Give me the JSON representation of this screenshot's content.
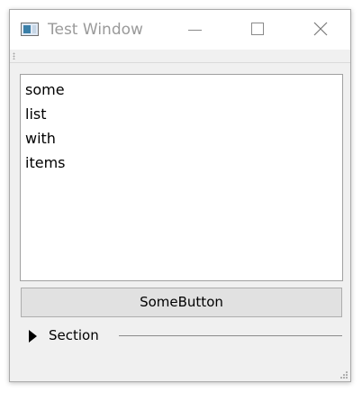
{
  "window": {
    "title": "Test Window"
  },
  "list": {
    "items": [
      "some",
      "list",
      "with",
      "items"
    ]
  },
  "button": {
    "label": "SomeButton"
  },
  "section": {
    "label": "Section",
    "expanded": false
  },
  "icons": {
    "app": "window-icon",
    "minimize": "minimize-icon",
    "maximize": "maximize-icon",
    "close": "close-icon",
    "toolbar_grip": "grip-icon",
    "section_toggle": "triangle-right-icon",
    "resize": "size-grip-icon"
  }
}
